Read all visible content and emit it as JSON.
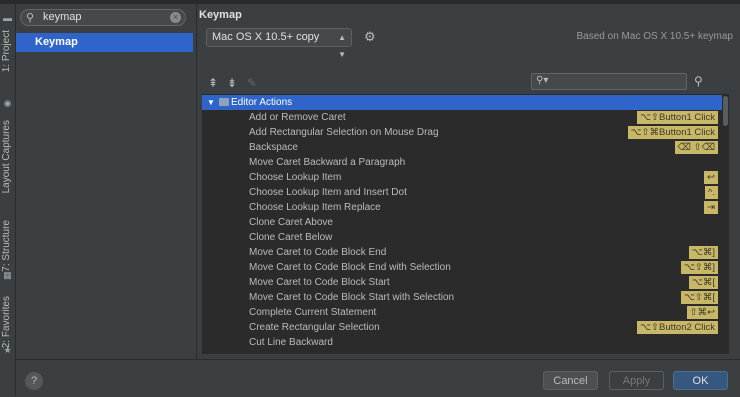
{
  "left_strip": {
    "tabs": [
      {
        "label": "1: Project",
        "icon": "folder-icon"
      },
      {
        "label": "Layout Captures",
        "icon": "capture-icon"
      },
      {
        "label": "7: Structure",
        "icon": "structure-icon"
      },
      {
        "label": "2: Favorites",
        "icon": "star-icon"
      }
    ]
  },
  "sidebar": {
    "search_value": "keymap",
    "selected_item": "Keymap"
  },
  "keymap": {
    "header": "Keymap",
    "scheme": "Mac OS X 10.5+ copy",
    "based_on": "Based on Mac OS X 10.5+ keymap"
  },
  "tree": {
    "group": "Editor Actions",
    "rows": [
      {
        "name": "Add or Remove Caret",
        "shortcut": "⌥⇧Button1 Click"
      },
      {
        "name": "Add Rectangular Selection on Mouse Drag",
        "shortcut": "⌥⇧⌘Button1 Click"
      },
      {
        "name": "Backspace",
        "shortcut": "⌫ ⇧⌫"
      },
      {
        "name": "Move Caret Backward a Paragraph",
        "shortcut": ""
      },
      {
        "name": "Choose Lookup Item",
        "shortcut": "↩"
      },
      {
        "name": "Choose Lookup Item and Insert Dot",
        "shortcut": "^."
      },
      {
        "name": "Choose Lookup Item Replace",
        "shortcut": "⇥"
      },
      {
        "name": "Clone Caret Above",
        "shortcut": ""
      },
      {
        "name": "Clone Caret Below",
        "shortcut": ""
      },
      {
        "name": "Move Caret to Code Block End",
        "shortcut": "⌥⌘]"
      },
      {
        "name": "Move Caret to Code Block End with Selection",
        "shortcut": "⌥⇧⌘]"
      },
      {
        "name": "Move Caret to Code Block Start",
        "shortcut": "⌥⌘["
      },
      {
        "name": "Move Caret to Code Block Start with Selection",
        "shortcut": "⌥⇧⌘["
      },
      {
        "name": "Complete Current Statement",
        "shortcut": "⇧⌘↩"
      },
      {
        "name": "Create Rectangular Selection",
        "shortcut": "⌥⇧Button2 Click"
      },
      {
        "name": "Cut Line Backward",
        "shortcut": ""
      }
    ]
  },
  "buttons": {
    "help": "?",
    "cancel": "Cancel",
    "apply": "Apply",
    "ok": "OK"
  }
}
